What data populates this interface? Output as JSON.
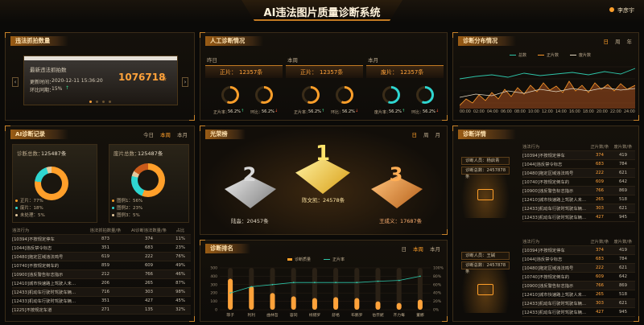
{
  "header": {
    "title": "AI违法图片质量诊断系统",
    "user": "李彦宇"
  },
  "p1": {
    "title": "违法抓拍数量",
    "card_label": "最新违法抓拍数",
    "update_label": "更新时间：",
    "update_time": "2020-12-11 15:36:20",
    "compare_label": "环比同期：",
    "compare_value": "15%",
    "count": "1076718",
    "unit": "条"
  },
  "p2": {
    "title": "人工诊断情况",
    "cols": [
      {
        "period": "昨日",
        "label": "正片：",
        "value": "12357条",
        "r1": "正片率：",
        "v1": "56.2%",
        "r2": "环比：",
        "v2": "56.2%"
      },
      {
        "period": "本周",
        "label": "正片：",
        "value": "12357条",
        "r1": "正片率：",
        "v1": "56.2%",
        "r2": "环比：",
        "v2": "56.2%"
      },
      {
        "period": "本月",
        "label": "废片：",
        "value": "12357条",
        "r1": "废片率：",
        "v1": "56.2%",
        "r2": "环比：",
        "v2": "56.2%"
      }
    ]
  },
  "p3": {
    "title": "诊断分布情况",
    "tabs": [
      "日",
      "周",
      "年"
    ],
    "legend": [
      "总数",
      "正片数",
      "废片数"
    ],
    "colors": [
      "#2ec4a8",
      "#ff9a2b",
      "#e3d7c0"
    ]
  },
  "p4": {
    "title": "AI诊断记录",
    "tabs": [
      "今日",
      "本周",
      "本月"
    ],
    "left": {
      "title": "诊断总数：",
      "value": "125487条",
      "items": [
        {
          "name": "正片：",
          "value": "77%",
          "color": "#ff9f2a"
        },
        {
          "name": "废片：",
          "value": "18%",
          "color": "#2fd6d0"
        },
        {
          "name": "未处理：",
          "value": "5%",
          "color": "#e3c89d"
        }
      ]
    },
    "right": {
      "title": "废片总数：",
      "value": "125487条",
      "items": [
        {
          "name": "图例1：",
          "value": "56%",
          "color": "#ff9f2a"
        },
        {
          "name": "图例2：",
          "value": "23%",
          "color": "#2fd6d0"
        },
        {
          "name": "图例3：",
          "value": "5%",
          "color": "#e3c89d"
        }
      ]
    },
    "headers": [
      "违法行为",
      "违法抓拍数量/条",
      "AI诊断违法数量/条",
      "占比"
    ],
    "rows": [
      [
        "[10394]不按规定停车",
        "873",
        "374",
        "11%"
      ],
      [
        "[1044]违反禁令标志",
        "351",
        "683",
        "23%"
      ],
      [
        "[10480]拖定区域违法鸣号",
        "619",
        "222",
        "76%"
      ],
      [
        "[10740]不按规定倒车的",
        "859",
        "609",
        "49%"
      ],
      [
        "[10900]违反警告标志指示",
        "212",
        "766",
        "46%"
      ],
      [
        "[12410]城市快速路上驾驶人未...",
        "206",
        "265",
        "87%"
      ],
      [
        "[12433]机动车行驶时驾驶车辆...",
        "716",
        "303",
        "98%"
      ],
      [
        "[12433]机动车行驶时驾驶车辆...",
        "351",
        "427",
        "45%"
      ],
      [
        "[1225]不按规定车道",
        "271",
        "135",
        "32%"
      ]
    ]
  },
  "p5": {
    "title": "光荣榜",
    "tabs": [
      "日",
      "周",
      "月"
    ],
    "first": "陈文凯：24578条",
    "second": "陆淼：20457条",
    "third": "王成义：17687条"
  },
  "p6": {
    "title": "诊断排名",
    "tabs": [
      "日",
      "本周",
      "本月"
    ],
    "legend": [
      "诊断质量",
      "正片率"
    ]
  },
  "chart_data": {
    "type": "bar",
    "categories": [
      "菲子",
      "利利",
      "曲林哲",
      "容同",
      "线镨罗",
      "舒格",
      "布鹏罗",
      "伯奈妮",
      "齐力每",
      "董娜"
    ],
    "series": [
      {
        "name": "诊断质量",
        "values": [
          370,
          280,
          200,
          160,
          140,
          150,
          140,
          100,
          80,
          120
        ]
      },
      {
        "name": "正片率",
        "values": [
          40,
          55,
          60,
          65,
          65,
          65,
          65,
          68,
          70,
          80
        ]
      }
    ],
    "ylim_left": [
      0,
      500
    ],
    "ylim_right": [
      0,
      100
    ],
    "yticks_left": [
      "0",
      "100",
      "200",
      "300",
      "400",
      "500"
    ],
    "yticks_right": [
      "0%",
      "20%",
      "40%",
      "60%",
      "80%",
      "100%"
    ]
  },
  "p7": {
    "title": "诊断详情",
    "groups": [
      {
        "user_label": "诊断人员：杨启青",
        "total_label": "诊断总数：",
        "total": "2457878条",
        "headers": [
          "违法行为",
          "正片数/条",
          "废片数/条"
        ],
        "rows": [
          [
            "[10394]不按规定停车",
            "374",
            "419"
          ],
          [
            "[1044]违反禁令标志",
            "683",
            "784"
          ],
          [
            "[10480]拖定区域违法鸣号",
            "222",
            "621"
          ],
          [
            "[10740]不按规定倒车的",
            "609",
            "642"
          ],
          [
            "[10900]违反警告标志指示",
            "766",
            "869"
          ],
          [
            "[12410]城市快速路上驾驶人未...",
            "265",
            "518"
          ],
          [
            "[12433]机动车行驶时驾驶车辆...",
            "303",
            "621"
          ],
          [
            "[12433]机动车行驶时驾驶车辆...",
            "427",
            "945"
          ]
        ]
      },
      {
        "user_label": "诊断人员：王碱",
        "total_label": "诊断总数：",
        "total": "2457878条",
        "headers": [
          "违法行为",
          "正片数/条",
          "废片数/条"
        ],
        "rows": [
          [
            "[10394]不按规定停车",
            "374",
            "419"
          ],
          [
            "[1044]违反禁令标志",
            "683",
            "784"
          ],
          [
            "[10480]拖定区域违法鸣号",
            "222",
            "621"
          ],
          [
            "[10740]不按规定倒车的",
            "609",
            "642"
          ],
          [
            "[10900]违反警告标志指示",
            "766",
            "869"
          ],
          [
            "[12410]城市快速路上驾驶人未...",
            "265",
            "518"
          ],
          [
            "[12433]机动车行驶时驾驶车辆...",
            "303",
            "621"
          ],
          [
            "[12433]机动车行驶时驾驶车辆...",
            "427",
            "945"
          ]
        ]
      }
    ]
  },
  "timeline": [
    "00:00",
    "02:00",
    "04:00",
    "06:00",
    "08:00",
    "10:00",
    "12:00",
    "14:00",
    "16:00",
    "18:00",
    "20:00",
    "22:00",
    "24:00"
  ]
}
